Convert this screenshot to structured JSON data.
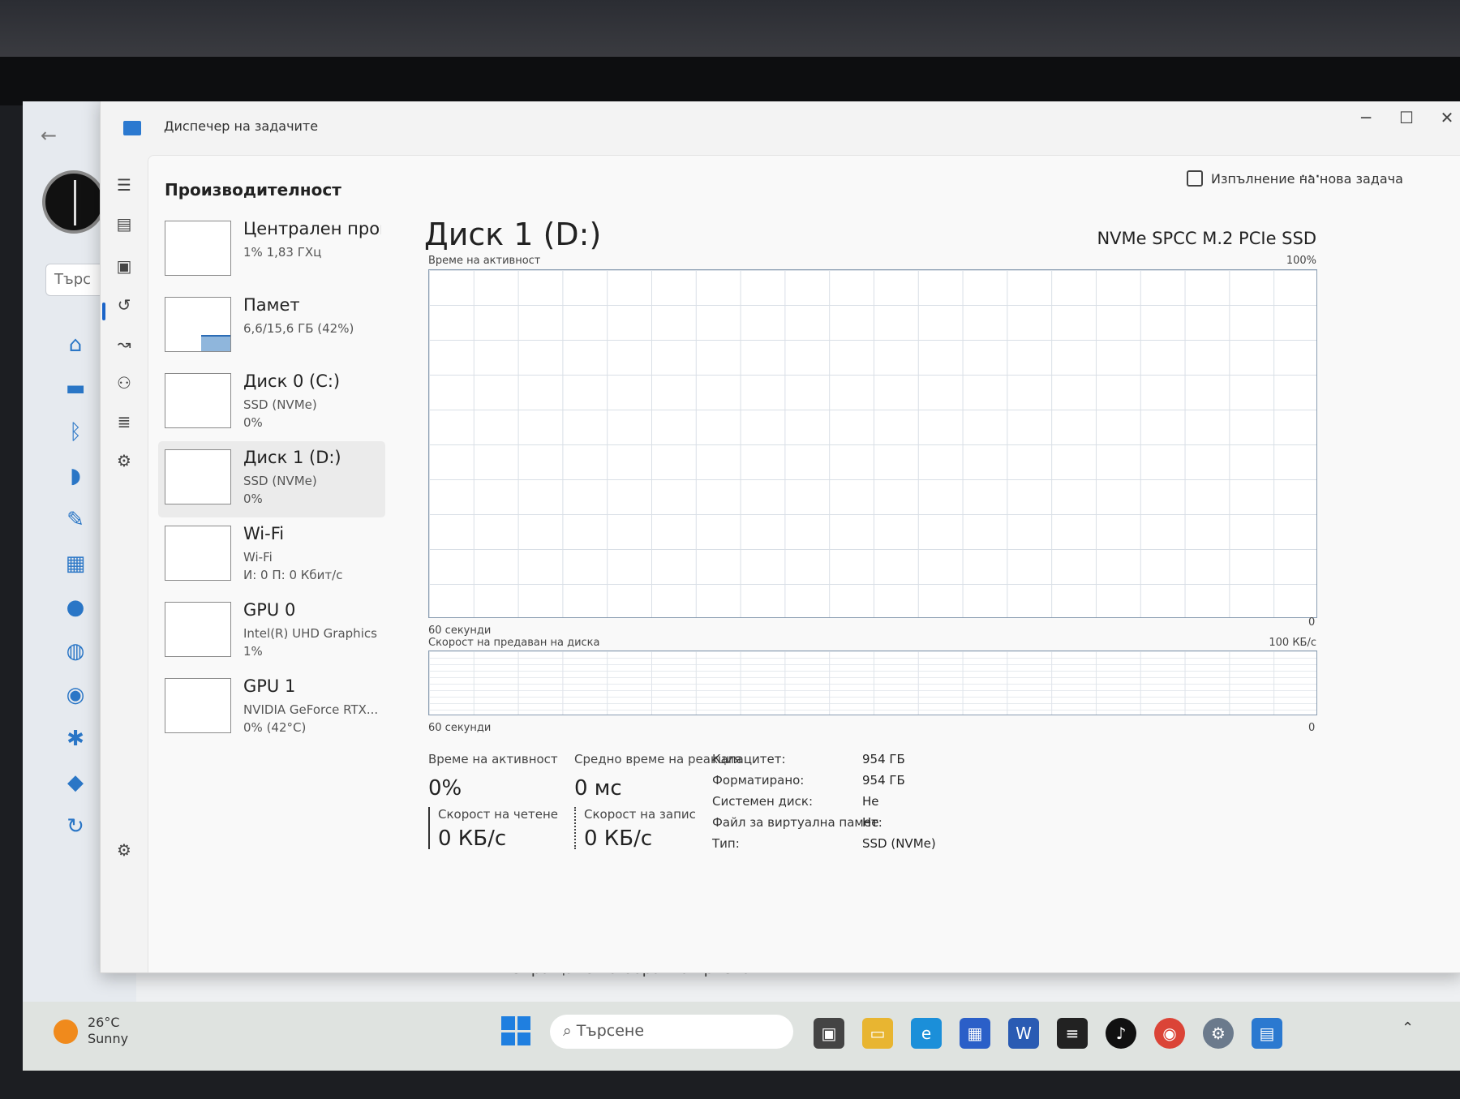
{
  "window": {
    "title": "Диспечер на задачите"
  },
  "header": {
    "title": "Производителност",
    "run_task": "Изпълнение на нова задача",
    "more": "···"
  },
  "bg_app": {
    "search_placeholder": "Търс",
    "feedback": "Изпращане на обратна връзка"
  },
  "devices": [
    {
      "name": "Централен процесор",
      "line2": "1% 1,83 ГХц",
      "line3": ""
    },
    {
      "name": "Памет",
      "line2": "6,6/15,6 ГБ (42%)",
      "line3": ""
    },
    {
      "name": "Диск 0 (C:)",
      "line2": "SSD (NVMe)",
      "line3": "0%"
    },
    {
      "name": "Диск 1 (D:)",
      "line2": "SSD (NVMe)",
      "line3": "0%"
    },
    {
      "name": "Wi-Fi",
      "line2": "Wi-Fi",
      "line3": "И: 0 П: 0 Кбит/с"
    },
    {
      "name": "GPU 0",
      "line2": "Intel(R) UHD Graphics",
      "line3": "1%"
    },
    {
      "name": "GPU 1",
      "line2": "NVIDIA GeForce RTX...",
      "line3": "0% (42°C)"
    }
  ],
  "detail": {
    "title": "Диск 1 (D:)",
    "model": "NVMe SPCC M.2 PCIe SSD",
    "chart1": {
      "label": "Време на активност",
      "max": "100%",
      "time": "60 секунди",
      "min": "0"
    },
    "chart2": {
      "label": "Скорост на предаван на диска",
      "max": "100 КБ/с",
      "time": "60 секунди",
      "min": "0"
    },
    "stats": {
      "active_time_label": "Време на активност",
      "active_time": "0%",
      "response_label": "Средно време на реакция",
      "response": "0 мс",
      "read_label": "Скорост на четене",
      "read": "0 КБ/с",
      "write_label": "Скорост на запис",
      "write": "0 КБ/с"
    },
    "props": [
      {
        "k": "Капацитет:",
        "v": "954 ГБ"
      },
      {
        "k": "Форматирано:",
        "v": "954 ГБ"
      },
      {
        "k": "Системен диск:",
        "v": "Не"
      },
      {
        "k": "Файл за виртуална памет:",
        "v": "Не"
      },
      {
        "k": "Тип:",
        "v": "SSD (NVMe)"
      }
    ]
  },
  "taskbar": {
    "temp": "26°C",
    "weather": "Sunny",
    "search": "Търсене"
  }
}
